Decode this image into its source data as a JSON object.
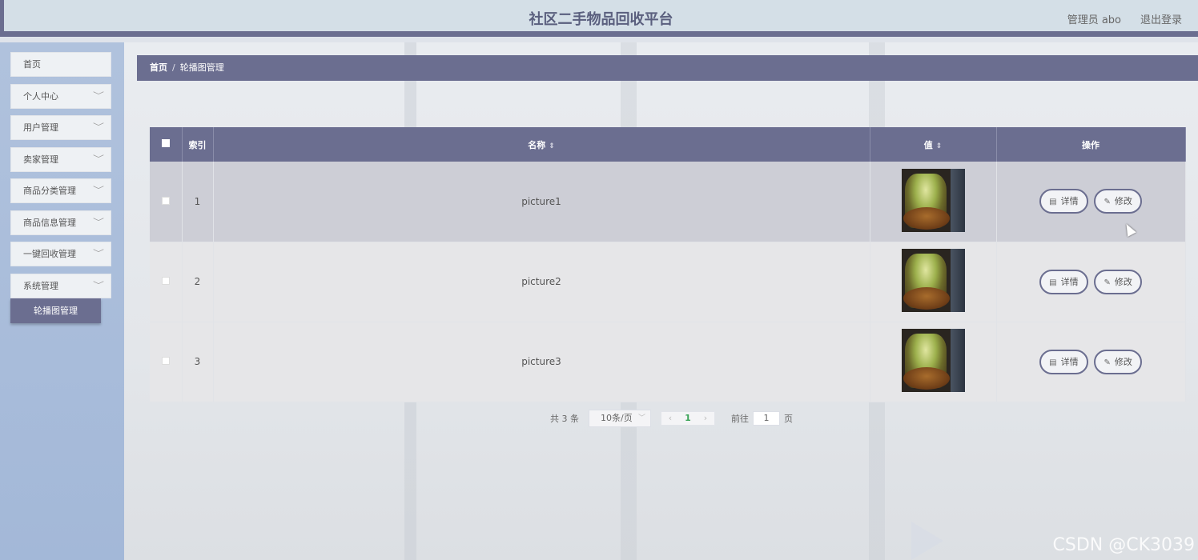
{
  "app": {
    "title": "社区二手物品回收平台",
    "user": "管理员 abo",
    "logout": "退出登录"
  },
  "sidebar": {
    "items": [
      {
        "label": "首页",
        "has_children": false
      },
      {
        "label": "个人中心",
        "has_children": true
      },
      {
        "label": "用户管理",
        "has_children": true
      },
      {
        "label": "卖家管理",
        "has_children": true
      },
      {
        "label": "商品分类管理",
        "has_children": true
      },
      {
        "label": "商品信息管理",
        "has_children": true
      },
      {
        "label": "一键回收管理",
        "has_children": true
      },
      {
        "label": "系统管理",
        "has_children": true
      }
    ],
    "chevron": "﹀",
    "active_submenu": "轮播图管理"
  },
  "breadcrumb": {
    "home": "首页",
    "separator": "/",
    "current": "轮播图管理"
  },
  "table": {
    "columns": {
      "index": "索引",
      "name": "名称",
      "value": "值",
      "actions": "操作"
    },
    "sort_icon": "⇕",
    "rows": [
      {
        "index": "1",
        "name": "picture1",
        "image": "food-thumbnail",
        "hovered": true
      },
      {
        "index": "2",
        "name": "picture2",
        "image": "food-thumbnail",
        "hovered": false
      },
      {
        "index": "3",
        "name": "picture3",
        "image": "food-thumbnail",
        "hovered": false
      }
    ],
    "detail_label": "详情",
    "edit_label": "修改",
    "detail_icon": "▤",
    "edit_icon": "✎"
  },
  "pagination": {
    "total": "共 3 条",
    "page_size": "10条/页",
    "prev": "‹",
    "current_page": "1",
    "next": "›",
    "goto_label": "前往",
    "goto_value": "1",
    "page_unit": "页"
  },
  "watermark": {
    "text": "CSDN @CK3039"
  },
  "colors": {
    "accent": "#6b6e90",
    "sidebar": "#a3b8d8",
    "header": "#d4dfe7",
    "current_page": "#3aa357"
  }
}
